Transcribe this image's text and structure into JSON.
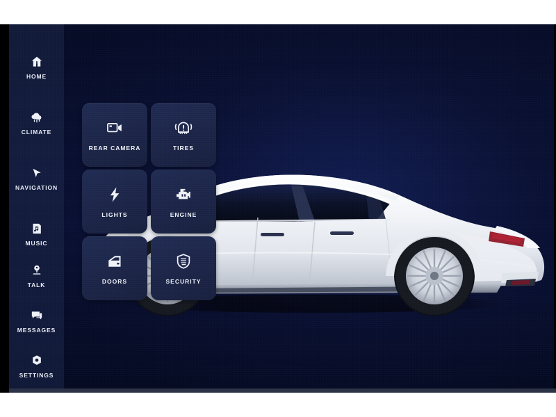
{
  "app": {
    "title": "Car Dashboard Controls",
    "background_color": "#070d2c",
    "sidebar_color": "#131c3e",
    "tile_color": "#1b2447",
    "text_color": "#eef1f8",
    "bezel_color": "#000000"
  },
  "sidebar": {
    "items": [
      {
        "label": "HOME",
        "icon": "home-icon"
      },
      {
        "label": "CLIMATE",
        "icon": "cloud-rain-icon"
      },
      {
        "label": "NAVIGATION",
        "icon": "navigation-cursor-icon"
      },
      {
        "label": "MUSIC",
        "icon": "music-note-icon"
      },
      {
        "label": "TALK",
        "icon": "microphone-icon"
      },
      {
        "label": "MESSAGES",
        "icon": "chat-bubbles-icon"
      },
      {
        "label": "SETTINGS",
        "icon": "gear-icon"
      }
    ]
  },
  "main": {
    "tiles": [
      {
        "label": "REAR CAMERA",
        "icon": "video-camera-icon"
      },
      {
        "label": "TIRES",
        "icon": "tire-pressure-warning-icon"
      },
      {
        "label": "LIGHTS",
        "icon": "lightning-bolt-icon"
      },
      {
        "label": "ENGINE",
        "icon": "check-engine-icon"
      },
      {
        "label": "DOORS",
        "icon": "car-door-icon"
      },
      {
        "label": "SECURITY",
        "icon": "shield-icon"
      }
    ],
    "vehicle_image": {
      "name": "white-sedan-side-profile",
      "body_color": "#fdfdfd",
      "glass_color": "#0b1228",
      "taillight_color": "#8e1020"
    }
  }
}
